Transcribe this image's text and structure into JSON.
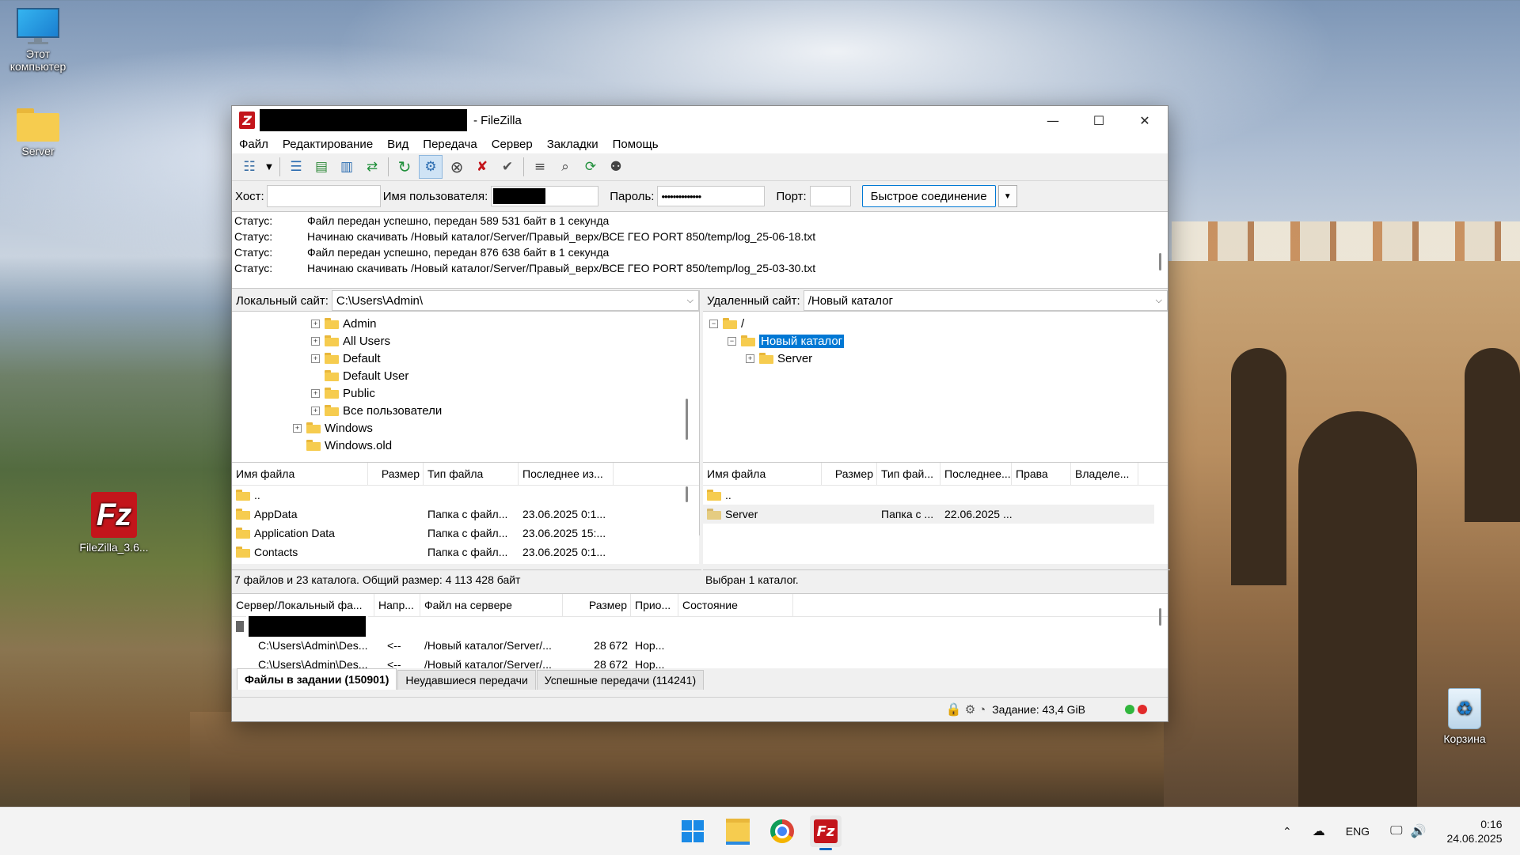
{
  "desktop": {
    "icons": [
      {
        "label_line1": "Этот",
        "label_line2": "компьютер"
      },
      {
        "label_line1": "Server",
        "label_line2": ""
      },
      {
        "label_line1": "FileZilla_3.6...",
        "label_line2": ""
      },
      {
        "label_line1": "Корзина",
        "label_line2": ""
      }
    ]
  },
  "window": {
    "title": "- FileZilla",
    "menu": [
      "Файл",
      "Редактирование",
      "Вид",
      "Передача",
      "Сервер",
      "Закладки",
      "Помощь"
    ],
    "quickconnect": {
      "host_label": "Хост:",
      "user_label": "Имя пользователя:",
      "pass_label": "Пароль:",
      "pass_value": "••••••••••••••",
      "port_label": "Порт:",
      "button": "Быстрое соединение"
    },
    "log": [
      {
        "k": "Статус:",
        "v": "Файл передан успешно, передан 589 531 байт в 1 секунда"
      },
      {
        "k": "Статус:",
        "v": "Начинаю скачивать /Новый каталог/Server/Правый_верх/ВСЕ ГЕО PORT 850/temp/log_25-06-18.txt"
      },
      {
        "k": "Статус:",
        "v": "Файл передан успешно, передан 876 638 байт в 1 секунда"
      },
      {
        "k": "Статус:",
        "v": "Начинаю скачивать /Новый каталог/Server/Правый_верх/ВСЕ ГЕО PORT 850/temp/log_25-03-30.txt"
      }
    ],
    "local": {
      "site_label": "Локальный сайт:",
      "path": "C:\\Users\\Admin\\",
      "tree": [
        "Admin",
        "All Users",
        "Default",
        "Default User",
        "Public",
        "Все пользователи",
        "Windows",
        "Windows.old"
      ],
      "columns": [
        "Имя файла",
        "Размер",
        "Тип файла",
        "Последнее из..."
      ],
      "rows": [
        {
          "name": "..",
          "size": "",
          "type": "",
          "modified": ""
        },
        {
          "name": "AppData",
          "size": "",
          "type": "Папка с файл...",
          "modified": "23.06.2025 0:1..."
        },
        {
          "name": "Application Data",
          "size": "",
          "type": "Папка с файл...",
          "modified": "23.06.2025 15:..."
        },
        {
          "name": "Contacts",
          "size": "",
          "type": "Папка с файл...",
          "modified": "23.06.2025 0:1..."
        }
      ],
      "status": "7 файлов и 23 каталога. Общий размер: 4 113 428 байт"
    },
    "remote": {
      "site_label": "Удаленный сайт:",
      "path": "/Новый каталог",
      "tree": [
        "/",
        "Новый каталог",
        "Server"
      ],
      "columns": [
        "Имя файла",
        "Размер",
        "Тип фай...",
        "Последнее...",
        "Права",
        "Владеле..."
      ],
      "rows": [
        {
          "name": "..",
          "size": "",
          "type": "",
          "modified": ""
        },
        {
          "name": "Server",
          "size": "",
          "type": "Папка с ...",
          "modified": "22.06.2025 ..."
        }
      ],
      "status": "Выбран 1 каталог."
    },
    "queue": {
      "columns": [
        "Сервер/Локальный фа...",
        "Напр...",
        "Файл на сервере",
        "Размер",
        "Прио...",
        "Состояние"
      ],
      "rows": [
        {
          "local": "C:\\Users\\Admin\\Des...",
          "dir": "<--",
          "remote": "/Новый каталог/Server/...",
          "size": "28 672",
          "prio": "Нор..."
        },
        {
          "local": "C:\\Users\\Admin\\Des...",
          "dir": "<--",
          "remote": "/Новый каталог/Server/...",
          "size": "28 672",
          "prio": "Нор..."
        }
      ]
    },
    "tabs": [
      "Файлы в задании (150901)",
      "Неудавшиеся передачи",
      "Успешные передачи (114241)"
    ],
    "statusbar": {
      "queue": "Задание: 43,4 GiB"
    }
  },
  "taskbar": {
    "lang": "ENG",
    "time": "0:16",
    "date": "24.06.2025"
  },
  "colors": {
    "accent": "#0078d4",
    "filezilla_red": "#c3151b",
    "folder": "#f6cc4f"
  }
}
